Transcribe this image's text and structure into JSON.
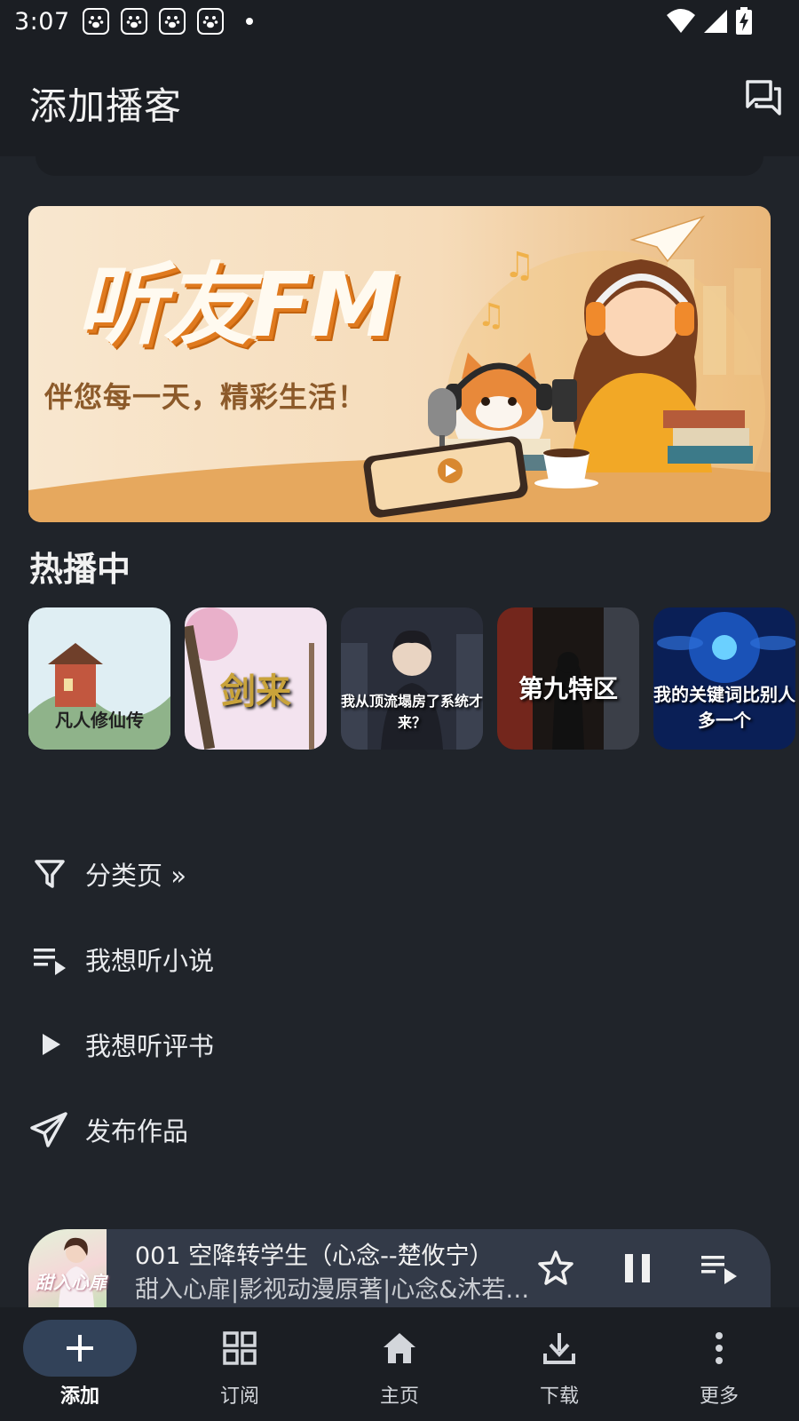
{
  "status_bar": {
    "time": "3:07",
    "notification_icons": [
      "paw-icon",
      "paw-icon",
      "paw-icon",
      "paw-icon"
    ],
    "right_icons": [
      "wifi-icon",
      "signal-icon",
      "battery-charging-icon"
    ]
  },
  "app_bar": {
    "title": "添加播客",
    "action_icon": "chat-bubbles-icon"
  },
  "banner": {
    "title": "听友FM",
    "subtitle": "伴您每一天，精彩生活！"
  },
  "hot_section": {
    "title": "热播中",
    "items": [
      {
        "cover_text": "凡人修仙传",
        "colors": [
          "#cfe6ef",
          "#8fb38a",
          "#c2573f"
        ]
      },
      {
        "cover_text": "剑来",
        "colors": [
          "#f3e3ef",
          "#d8c6a5",
          "#e6a3c1"
        ]
      },
      {
        "cover_text": "我从顶流塌房了系统才来？",
        "colors": [
          "#2a2e3a",
          "#5b6271",
          "#9aa3b4"
        ]
      },
      {
        "cover_text": "第九特区",
        "colors": [
          "#1b1614",
          "#8a2a1e",
          "#3b3f48"
        ]
      },
      {
        "cover_text": "我的关键词比别人多一个",
        "colors": [
          "#0a1f56",
          "#1e5fcf",
          "#6bd0ff"
        ]
      }
    ]
  },
  "menu": [
    {
      "icon": "filter-icon",
      "label": "分类页 »"
    },
    {
      "icon": "playlist-play-icon",
      "label": "我想听小说"
    },
    {
      "icon": "play-icon",
      "label": "我想听评书"
    },
    {
      "icon": "send-icon",
      "label": "发布作品"
    }
  ],
  "now_playing": {
    "cover_text": "甜入心扉",
    "title": "001 空降转学生（心念--楚攸宁）",
    "subtitle": "甜入心扉|影视动漫原著|心念&沐若|...",
    "buttons": [
      "star-icon",
      "pause-icon",
      "queue-icon"
    ]
  },
  "bottom_nav": [
    {
      "icon": "plus-icon",
      "label": "添加",
      "active": true
    },
    {
      "icon": "grid-icon",
      "label": "订阅",
      "active": false
    },
    {
      "icon": "home-icon",
      "label": "主页",
      "active": false
    },
    {
      "icon": "download-icon",
      "label": "下载",
      "active": false
    },
    {
      "icon": "more-vert-icon",
      "label": "更多",
      "active": false
    }
  ]
}
